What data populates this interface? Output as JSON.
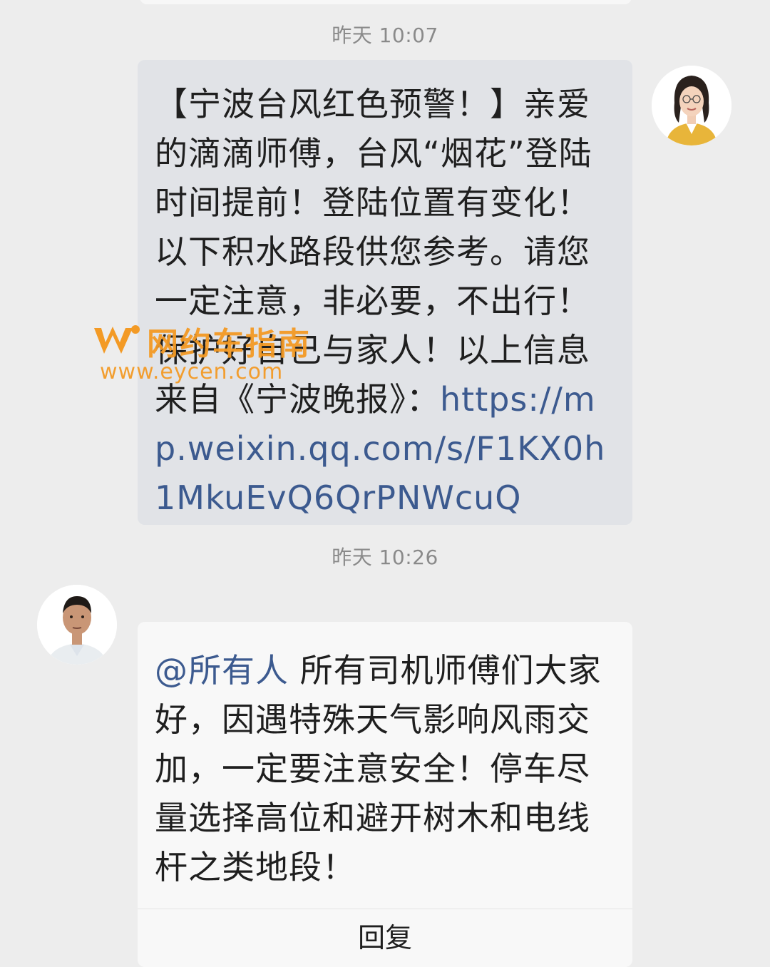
{
  "chat": {
    "timestamp_1": "昨天 10:07",
    "timestamp_2": "昨天 10:26",
    "message_1": {
      "text": "【宁波台风红色预警！】亲爱的滴滴师傅，台风“烟花”登陆时间提前！登陆位置有变化！以下积水路段供您参考。请您一定注意，非必要，不出行！保护好自己与家人！以上信息来自《宁波晚报》：",
      "link": "https://mp.weixin.qq.com/s/F1KX0h1MkuEvQ6QrPNWcuQ"
    },
    "message_2": {
      "mention": "@所有人",
      "text": " 所有司机师傅们大家好，因遇特殊天气影响风雨交加，一定要注意安全！停车尽量选择高位和避开树木和电线杆之类地段！",
      "reply_label": "回复"
    }
  },
  "watermark": {
    "title": "网约车指南",
    "url": "www.eycen.com"
  },
  "colors": {
    "background": "#ededed",
    "sent_bubble": "#e1e3e7",
    "received_bubble": "#f8f8f8",
    "link": "#3c5a8f",
    "watermark": "#f39a25"
  },
  "icons": {
    "avatar_sender": "avatar-woman-icon",
    "avatar_receiver": "avatar-man-icon",
    "watermark_logo": "w-logo-icon"
  }
}
